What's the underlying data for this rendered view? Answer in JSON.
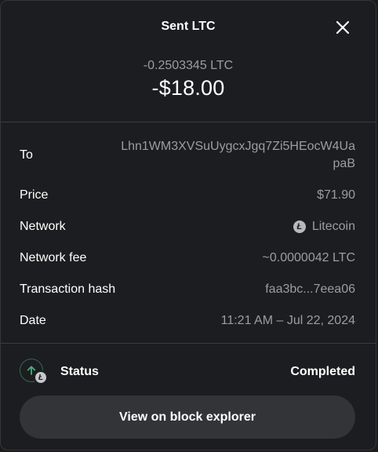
{
  "header": {
    "title": "Sent LTC",
    "crypto_amount": "-0.2503345 LTC",
    "fiat_amount": "-$18.00"
  },
  "details": {
    "to_label": "To",
    "to_value": "Lhn1WM3XVSuUygcxJgq7Zi5HEocW4UapaB",
    "price_label": "Price",
    "price_value": "$71.90",
    "network_label": "Network",
    "network_value": "Litecoin",
    "network_fee_label": "Network fee",
    "network_fee_value": "~0.0000042 LTC",
    "tx_hash_label": "Transaction hash",
    "tx_hash_value": "faa3bc...7eea06",
    "date_label": "Date",
    "date_value": "11:21 AM – Jul 22, 2024"
  },
  "status": {
    "label": "Status",
    "value": "Completed"
  },
  "actions": {
    "explorer_label": "View on block explorer"
  },
  "icons": {
    "close": "close-icon",
    "litecoin": "litecoin-icon",
    "sent_arrow": "arrow-up-icon"
  },
  "colors": {
    "background": "#1c1d20",
    "muted_text": "#9a9da3",
    "status_green": "#3fb37a",
    "button_bg": "#323438"
  }
}
